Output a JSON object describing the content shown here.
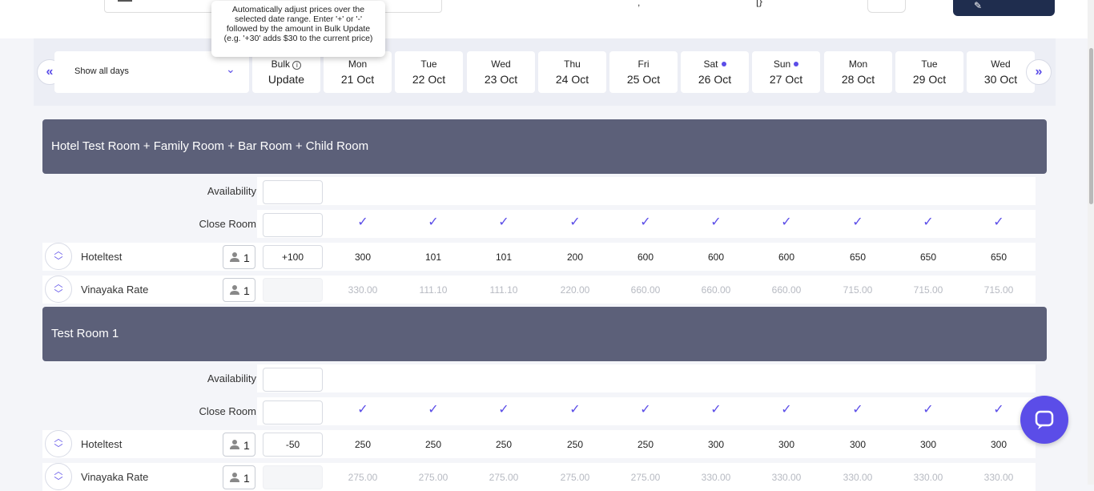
{
  "tooltip": {
    "text": "Automatically adjust prices over the selected date range. Enter '+' or '-' followed by the amount in Bulk Update (e.g. '+30' adds $30 to the current price)"
  },
  "filter": {
    "label": "Show all days"
  },
  "bulk": {
    "line1": "Bulk",
    "line2": "Update"
  },
  "dates": [
    {
      "dow": "Mon",
      "date": "21 Oct",
      "weekend": false
    },
    {
      "dow": "Tue",
      "date": "22 Oct",
      "weekend": false
    },
    {
      "dow": "Wed",
      "date": "23 Oct",
      "weekend": false
    },
    {
      "dow": "Thu",
      "date": "24 Oct",
      "weekend": false
    },
    {
      "dow": "Fri",
      "date": "25 Oct",
      "weekend": false
    },
    {
      "dow": "Sat",
      "date": "26 Oct",
      "weekend": true
    },
    {
      "dow": "Sun",
      "date": "27 Oct",
      "weekend": true
    },
    {
      "dow": "Mon",
      "date": "28 Oct",
      "weekend": false
    },
    {
      "dow": "Tue",
      "date": "29 Oct",
      "weekend": false
    },
    {
      "dow": "Wed",
      "date": "30 Oct",
      "weekend": false
    }
  ],
  "labels": {
    "availability": "Availability",
    "close_room": "Close Room"
  },
  "sections": [
    {
      "title": "Hotel Test Room + Family Room + Bar Room + Child Room",
      "rates": [
        {
          "name": "Hoteltest",
          "occupancy": "1",
          "bulk": "+100",
          "values": [
            "300",
            "101",
            "101",
            "200",
            "600",
            "600",
            "600",
            "650",
            "650",
            "650"
          ],
          "muted": false
        },
        {
          "name": "Vinayaka Rate",
          "occupancy": "1",
          "bulk": "",
          "values": [
            "330.00",
            "111.10",
            "111.10",
            "220.00",
            "660.00",
            "660.00",
            "660.00",
            "715.00",
            "715.00",
            "715.00"
          ],
          "muted": true
        }
      ]
    },
    {
      "title": "Test Room 1",
      "rates": [
        {
          "name": "Hoteltest",
          "occupancy": "1",
          "bulk": "-50",
          "values": [
            "250",
            "250",
            "250",
            "250",
            "250",
            "300",
            "300",
            "300",
            "300",
            "300"
          ],
          "muted": false
        },
        {
          "name": "Vinayaka Rate",
          "occupancy": "1",
          "bulk": "",
          "values": [
            "275.00",
            "275.00",
            "275.00",
            "275.00",
            "275.00",
            "330.00",
            "330.00",
            "330.00",
            "330.00",
            "330.00"
          ],
          "muted": true
        }
      ]
    }
  ],
  "icons": {
    "nav_prev": "double-chevron-left-icon",
    "nav_next": "double-chevron-right-icon",
    "chat": "chat-icon",
    "check": "check-icon",
    "person": "person-icon",
    "sort": "up-down-chevron-icon",
    "info": "info-icon"
  },
  "colors": {
    "accent": "#5b4de8",
    "section_header": "#5c6079",
    "dark_button": "#1f2d4e"
  }
}
